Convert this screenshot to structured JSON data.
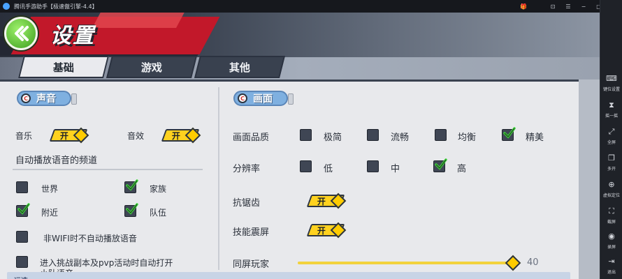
{
  "window": {
    "title": "腾讯手游助手【极速傲引擎-4.4】",
    "controls": [
      "⊡",
      "☰",
      "−",
      "□",
      "×"
    ]
  },
  "header": {
    "title": "设置",
    "back_icon": "back-arrow-icon"
  },
  "tabs": [
    {
      "label": "基础",
      "active": true
    },
    {
      "label": "游戏",
      "active": false
    },
    {
      "label": "其他",
      "active": false
    }
  ],
  "sound": {
    "section_title": "声音",
    "music_label": "音乐",
    "music_value": "开",
    "effects_label": "音效",
    "effects_value": "开",
    "voice_channel_title": "自动播放语音的频道",
    "channels": [
      {
        "label": "世界",
        "checked": false
      },
      {
        "label": "家族",
        "checked": true
      },
      {
        "label": "附近",
        "checked": true
      },
      {
        "label": "队伍",
        "checked": true
      }
    ],
    "no_wifi_label": "非WIFI时不自动播放语音",
    "no_wifi_checked": false,
    "challenge_label_line1": "进入挑战副本及pvp活动时自动打开",
    "challenge_label_line2": "小队语音",
    "challenge_checked": false
  },
  "graphics": {
    "section_title": "画面",
    "quality_label": "画面品质",
    "quality_options": [
      {
        "label": "极简",
        "checked": false
      },
      {
        "label": "流畅",
        "checked": false
      },
      {
        "label": "均衡",
        "checked": false
      },
      {
        "label": "精美",
        "checked": true
      }
    ],
    "resolution_label": "分辨率",
    "resolution_options": [
      {
        "label": "低",
        "checked": false
      },
      {
        "label": "中",
        "checked": false
      },
      {
        "label": "高",
        "checked": true
      }
    ],
    "antialias_label": "抗锯齿",
    "antialias_value": "开",
    "shake_label": "技能震屏",
    "shake_value": "开",
    "players_label": "同屏玩家",
    "players_value": "40",
    "players_fraction": 1.0
  },
  "bottom": {
    "partial_label": "运选"
  },
  "sidebar": [
    {
      "label": "键位设置",
      "icon": "keyboard-icon"
    },
    {
      "label": "摇一摇",
      "icon": "shake-icon"
    },
    {
      "label": "全屏",
      "icon": "fullscreen-icon"
    },
    {
      "label": "多开",
      "icon": "multi-instance-icon"
    },
    {
      "label": "虚拟定位",
      "icon": "location-icon"
    },
    {
      "label": "截屏",
      "icon": "screenshot-icon"
    },
    {
      "label": "录屏",
      "icon": "record-icon"
    },
    {
      "label": "退出",
      "icon": "exit-icon"
    }
  ],
  "colors": {
    "toggle": "#ffd21f",
    "section_pill": "#7fb0e0",
    "header_red": "#c2182a",
    "check_green": "#3cd13a"
  }
}
